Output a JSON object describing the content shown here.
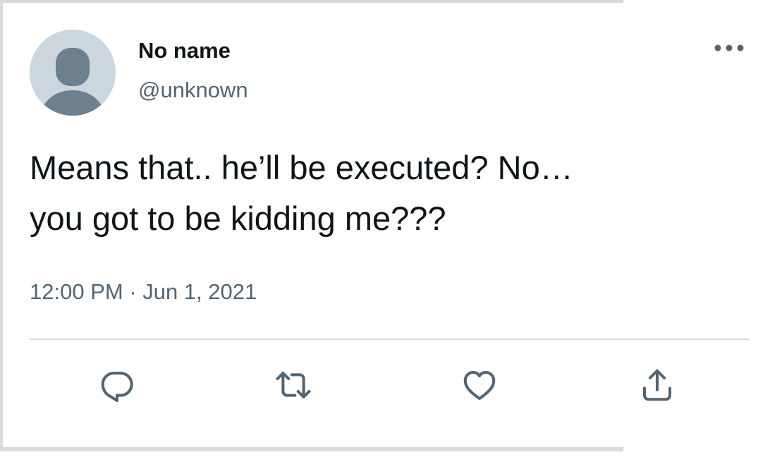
{
  "tweet": {
    "author": {
      "display_name": "No name",
      "handle": "@unknown",
      "avatar_icon": "default-avatar-icon"
    },
    "text": "Means that.. he’ll be executed? No…\nyou got to be kidding me???",
    "timestamp": "12:00 PM · Jun 1, 2021",
    "more_icon": "more-options-icon",
    "actions": [
      {
        "name": "reply",
        "icon": "reply-icon"
      },
      {
        "name": "retweet",
        "icon": "retweet-icon"
      },
      {
        "name": "like",
        "icon": "heart-icon"
      },
      {
        "name": "share",
        "icon": "share-icon"
      }
    ]
  },
  "colors": {
    "text_primary": "#0f1419",
    "text_secondary": "#536471",
    "avatar_bg": "#ccd6dd",
    "avatar_figure": "#6e7f8d",
    "divider": "#cfd9de",
    "icon": "#536471"
  }
}
